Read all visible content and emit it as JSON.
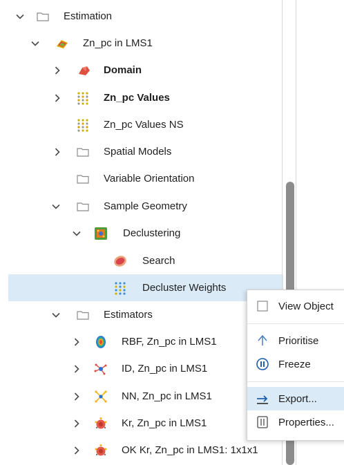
{
  "tree": {
    "estimation": {
      "label": "Estimation"
    },
    "zn_pc": {
      "label": "Zn_pc in LMS1"
    },
    "domain": {
      "label": "Domain"
    },
    "zn_pc_values": {
      "label": "Zn_pc Values"
    },
    "zn_pc_values_ns": {
      "label": "Zn_pc Values NS"
    },
    "spatial_models": {
      "label": "Spatial Models"
    },
    "variable_orientation": {
      "label": "Variable Orientation"
    },
    "sample_geometry": {
      "label": "Sample Geometry"
    },
    "declustering": {
      "label": "Declustering"
    },
    "search": {
      "label": "Search"
    },
    "decluster_weights": {
      "label": "Decluster Weights"
    },
    "estimators": {
      "label": "Estimators"
    },
    "rbf": {
      "label": "RBF, Zn_pc in LMS1"
    },
    "id": {
      "label": "ID, Zn_pc in LMS1"
    },
    "nn": {
      "label": "NN, Zn_pc in LMS1"
    },
    "kr": {
      "label": "Kr, Zn_pc in LMS1"
    },
    "ok_kr": {
      "label": "OK Kr, Zn_pc in LMS1: 1x1x1"
    }
  },
  "context_menu": {
    "view_object": "View Object",
    "prioritise": "Prioritise",
    "freeze": "Freeze",
    "export": "Export...",
    "properties": "Properties..."
  },
  "colors": {
    "selection": "#dbeaf7",
    "accent": "#1f5ea8",
    "folder_stroke": "#8a8a8a"
  }
}
